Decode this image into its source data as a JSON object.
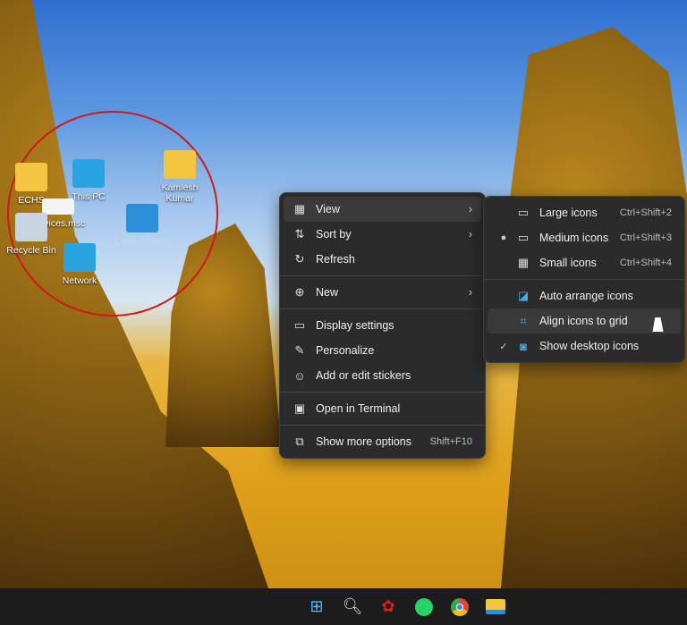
{
  "desktop": {
    "icons": [
      {
        "label": "ECHS",
        "icon": "folder-icon"
      },
      {
        "label": "This PC",
        "icon": "monitor-icon"
      },
      {
        "label": "Kamlesh Kumar",
        "icon": "user-folder-icon"
      },
      {
        "label": "services.msc",
        "icon": "services-icon"
      },
      {
        "label": "Recycle Bin",
        "icon": "recycle-bin-icon"
      },
      {
        "label": "Control Panel",
        "icon": "control-panel-icon"
      },
      {
        "label": "Network",
        "icon": "network-icon"
      }
    ]
  },
  "context_menu": {
    "items": [
      {
        "label": "View",
        "icon": "grid-icon",
        "submenu": true
      },
      {
        "label": "Sort by",
        "icon": "sort-icon",
        "submenu": true
      },
      {
        "label": "Refresh",
        "icon": "refresh-icon"
      },
      {
        "label": "New",
        "icon": "plus-circle-icon",
        "submenu": true
      },
      {
        "label": "Display settings",
        "icon": "display-icon"
      },
      {
        "label": "Personalize",
        "icon": "brush-icon"
      },
      {
        "label": "Add or edit stickers",
        "icon": "sticker-icon"
      },
      {
        "label": "Open in Terminal",
        "icon": "terminal-icon"
      },
      {
        "label": "Show more options",
        "icon": "more-options-icon",
        "shortcut": "Shift+F10"
      }
    ]
  },
  "view_submenu": {
    "items": [
      {
        "label": "Large icons",
        "shortcut": "Ctrl+Shift+2",
        "selected": false
      },
      {
        "label": "Medium icons",
        "shortcut": "Ctrl+Shift+3",
        "selected": true
      },
      {
        "label": "Small icons",
        "shortcut": "Ctrl+Shift+4",
        "selected": false
      },
      {
        "label": "Auto arrange icons",
        "checked": false
      },
      {
        "label": "Align icons to grid",
        "checked": false,
        "hovered": true
      },
      {
        "label": "Show desktop icons",
        "checked": true
      }
    ]
  },
  "taskbar": {
    "items": [
      "start",
      "search",
      "huawei",
      "whatsapp",
      "chrome",
      "file-explorer"
    ]
  },
  "colors": {
    "menu_bg": "#2b2b2b",
    "annotation_circle": "#d01818",
    "taskbar_bg": "#1c1c1c"
  }
}
